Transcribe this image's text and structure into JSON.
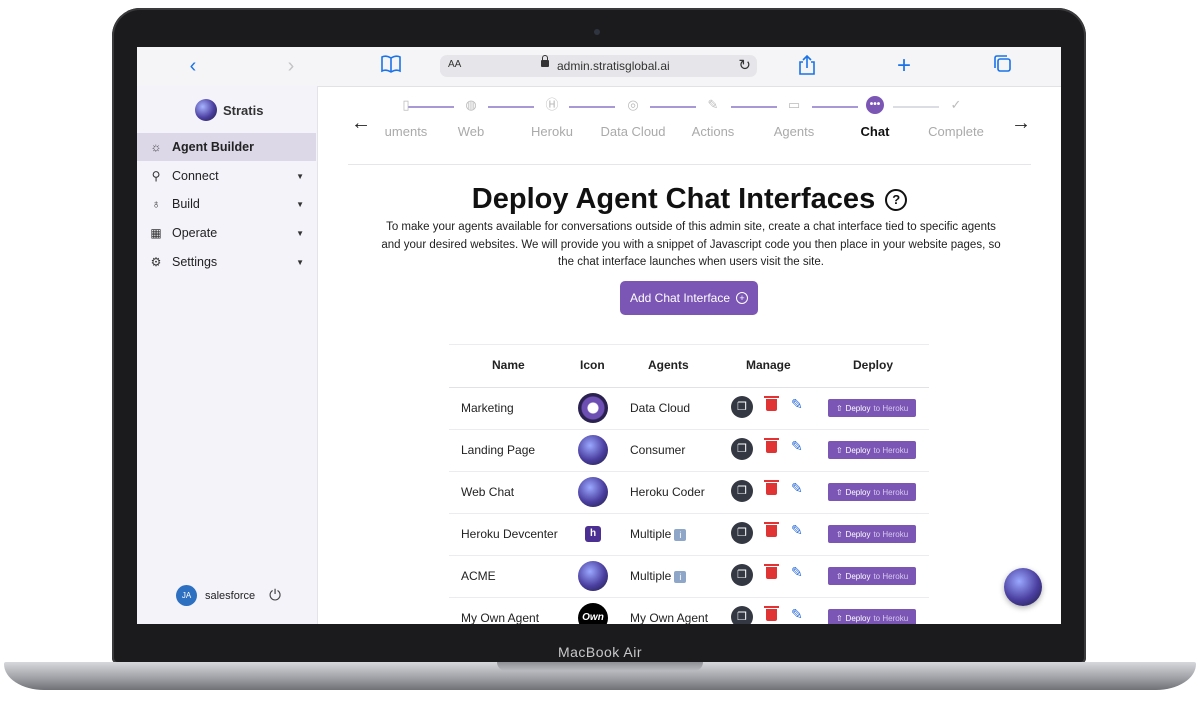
{
  "device": {
    "label": "MacBook Air"
  },
  "browser": {
    "text_size_label": "AA",
    "url": "admin.stratisglobal.ai",
    "icons": [
      "chevron-left-icon",
      "chevron-right-icon",
      "book-icon",
      "lock-icon",
      "reload-icon",
      "share-icon",
      "plus-icon",
      "tabs-icon"
    ]
  },
  "sidebar": {
    "brand": "Stratis",
    "items": [
      {
        "label": "Agent Builder",
        "icon": "sun-icon",
        "active": true
      },
      {
        "label": "Connect",
        "icon": "plug-icon",
        "caret": true
      },
      {
        "label": "Build",
        "icon": "lightbulb-icon",
        "caret": true
      },
      {
        "label": "Operate",
        "icon": "grid-icon",
        "caret": true
      },
      {
        "label": "Settings",
        "icon": "gear-icon",
        "caret": true
      }
    ],
    "user": {
      "initials": "JA",
      "name": "salesforce"
    }
  },
  "stepper": {
    "steps": [
      {
        "label": "uments",
        "icon": "document-icon"
      },
      {
        "label": "Web",
        "icon": "globe-icon"
      },
      {
        "label": "Heroku",
        "icon": "heroku-icon"
      },
      {
        "label": "Data Cloud",
        "icon": "data-cloud-icon"
      },
      {
        "label": "Actions",
        "icon": "wrench-icon"
      },
      {
        "label": "Agents",
        "icon": "id-card-icon"
      },
      {
        "label": "Chat",
        "icon": "chat-icon",
        "current": true
      },
      {
        "label": "Complete",
        "icon": "check-circle-icon"
      }
    ]
  },
  "content": {
    "title": "Deploy Agent Chat Interfaces",
    "description": "To make your agents available for conversations outside of this admin site, create a chat interface tied to specific agents and your desired websites. We will provide you with a snippet of Javascript code you then place in your website pages, so the chat interface launches when users visit the site.",
    "add_button": "Add Chat Interface",
    "accent_color": "#7b56b5"
  },
  "table": {
    "headers": {
      "name": "Name",
      "icon": "Icon",
      "agents": "Agents",
      "manage": "Manage",
      "deploy": "Deploy"
    },
    "deploy_label": "Deploy",
    "deploy_label_small": "to Heroku",
    "rows": [
      {
        "name": "Marketing",
        "agents": "Data Cloud",
        "icon": "marketing-avatar-icon"
      },
      {
        "name": "Landing Page",
        "agents": "Consumer",
        "icon": "stratis-logo-icon"
      },
      {
        "name": "Web Chat",
        "agents": "Heroku Coder",
        "icon": "stratis-logo-icon"
      },
      {
        "name": "Heroku Devcenter",
        "agents": "Multiple",
        "icon": "heroku-icon",
        "info": true
      },
      {
        "name": "ACME",
        "agents": "Multiple",
        "icon": "stratis-logo-icon",
        "info": true
      },
      {
        "name": "My Own Agent",
        "agents": "My Own Agent",
        "icon": "own-logo-icon",
        "icon_text": "Own"
      }
    ]
  }
}
